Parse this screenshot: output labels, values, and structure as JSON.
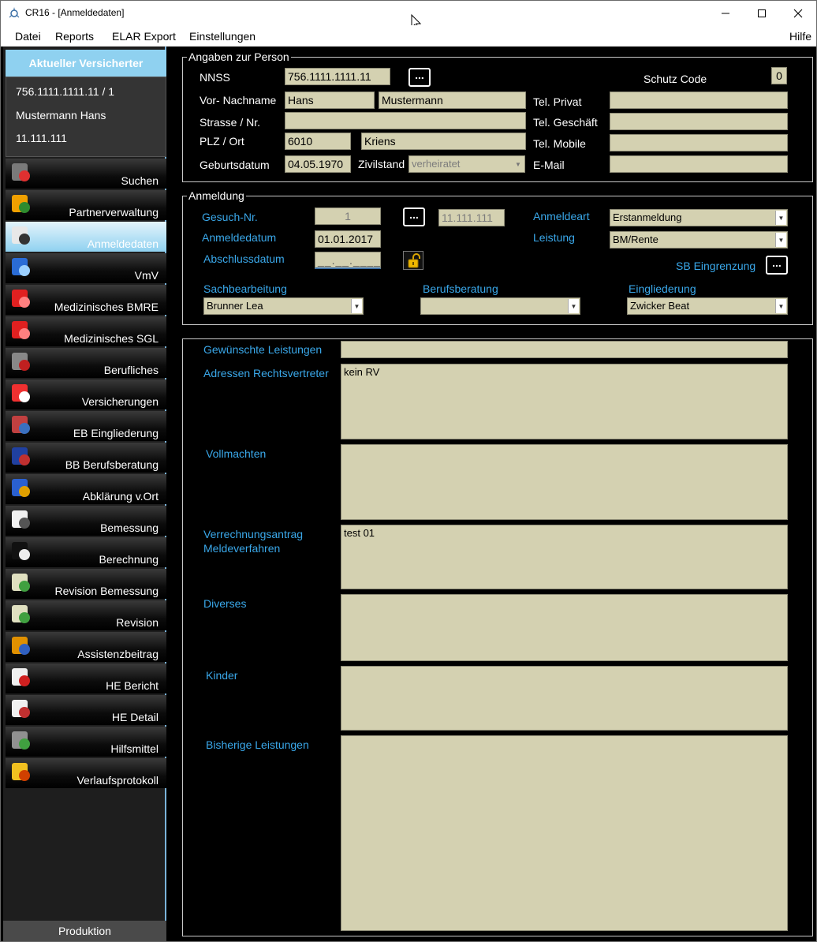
{
  "window": {
    "title": "CR16 - [Anmeldedaten]"
  },
  "menu": {
    "datei": "Datei",
    "reports": "Reports",
    "elar_export": "ELAR Export",
    "einstellungen": "Einstellungen",
    "hilfe": "Hilfe"
  },
  "sidebar": {
    "insured_header": "Aktueller Versicherter",
    "insured_nnss": "756.1111.1111.11 / 1",
    "insured_name": "Mustermann Hans",
    "insured_number": "11.111.111",
    "items": [
      {
        "label": "Suchen",
        "icon": "search-person-icon"
      },
      {
        "label": "Partnerverwaltung",
        "icon": "partner-icon"
      },
      {
        "label": "Anmeldedaten",
        "icon": "registration-icon"
      },
      {
        "label": "VmV",
        "icon": "globe-icon"
      },
      {
        "label": "Medizinisches BMRE",
        "icon": "medical-star-icon"
      },
      {
        "label": "Medizinisches SGL",
        "icon": "medical-star-icon"
      },
      {
        "label": "Berufliches",
        "icon": "tools-icon"
      },
      {
        "label": "Versicherungen",
        "icon": "lifebuoy-icon"
      },
      {
        "label": "EB Eingliederung",
        "icon": "group-icon"
      },
      {
        "label": "BB Berufsberatung",
        "icon": "globe-people-icon"
      },
      {
        "label": "Abklärung v.Ort",
        "icon": "onsite-icon"
      },
      {
        "label": "Bemessung",
        "icon": "document-icon"
      },
      {
        "label": "Berechnung",
        "icon": "calculator-icon"
      },
      {
        "label": "Revision Bemessung",
        "icon": "revision-doc-icon"
      },
      {
        "label": "Revision",
        "icon": "revision-doc-icon"
      },
      {
        "label": "Assistenzbeitrag",
        "icon": "assistant-icon"
      },
      {
        "label": "HE Bericht",
        "icon": "checklist-icon"
      },
      {
        "label": "HE Detail",
        "icon": "detail-doc-icon"
      },
      {
        "label": "Hilfsmittel",
        "icon": "wheelchair-icon"
      },
      {
        "label": "Verlaufsprotokoll",
        "icon": "folder-icon"
      }
    ],
    "active_index": 2,
    "footer": "Produktion"
  },
  "person": {
    "group_title": "Angaben zur Person",
    "nnss_label": "NNSS",
    "nnss_value": "756.1111.1111.11",
    "dots": "...",
    "schutz_label": "Schutz Code",
    "schutz_value": "0",
    "name_label": "Vor- Nachname",
    "first_name": "Hans",
    "last_name": "Mustermann",
    "street_label": "Strasse / Nr.",
    "street_value": "",
    "plz_label": "PLZ / Ort",
    "plz_value": "6010",
    "ort_value": "Kriens",
    "birth_label": "Geburtsdatum",
    "birth_value": "04.05.1970",
    "zivil_label": "Zivilstand",
    "zivil_value": "verheiratet",
    "tel_privat_label": "Tel. Privat",
    "tel_privat_value": "",
    "tel_geschaeft_label": "Tel. Geschäft",
    "tel_geschaeft_value": "",
    "tel_mobile_label": "Tel. Mobile",
    "tel_mobile_value": "",
    "email_label": "E-Mail",
    "email_value": ""
  },
  "anmeldung": {
    "group_title": "Anmeldung",
    "gesuch_label": "Gesuch-Nr.",
    "gesuch_value": "1",
    "gesuch_ref": "11.111.111",
    "anmeldedatum_label": "Anmeldedatum",
    "anmeldedatum_value": "01.01.2017",
    "abschluss_label": "Abschlussdatum",
    "abschluss_value": "__.__.____",
    "anmeldeart_label": "Anmeldeart",
    "anmeldeart_value": "Erstanmeldung",
    "leistung_label": "Leistung",
    "leistung_value": "BM/Rente",
    "sb_label": "SB Eingrenzung",
    "sach_label": "Sachbearbeitung",
    "sach_value": "Brunner Lea",
    "berufs_label": "Berufsberatung",
    "berufs_value": "",
    "eingl_label": "Eingliederung",
    "eingl_value": "Zwicker Beat"
  },
  "details": {
    "gewuenschte_label": "Gewünschte Leistungen",
    "gewuenschte_value": "",
    "adressen_label": "Adressen Rechtsvertreter",
    "adressen_value": "kein RV",
    "vollmachten_label": "Vollmachten",
    "vollmachten_value": "",
    "verrechnung_label1": "Verrechnungsantrag",
    "verrechnung_label2": "Meldeverfahren",
    "verrechnung_value": "test 01",
    "diverses_label": "Diverses",
    "diverses_value": "",
    "kinder_label": "Kinder",
    "kinder_value": "",
    "bisherige_label": "Bisherige Leistungen",
    "bisherige_value": ""
  }
}
